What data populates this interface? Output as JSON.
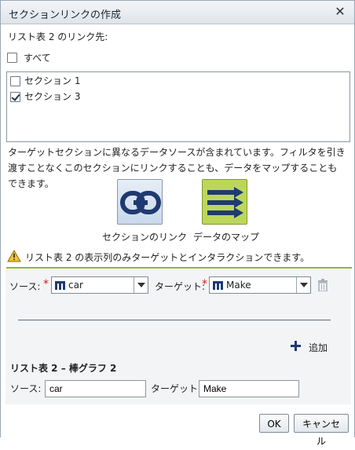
{
  "dialog": {
    "title": "セクションリンクの作成",
    "close_icon": "close-icon"
  },
  "link_target": {
    "label": "リスト表 2 のリンク先:",
    "all_label": "すべて",
    "all_checked": false,
    "sections": [
      {
        "label": "セクション 1",
        "checked": false
      },
      {
        "label": "セクション 3",
        "checked": true
      }
    ]
  },
  "info_text": "ターゲットセクションに異なるデータソースが含まれています。フィルタを引き渡すことなくこのセクションにリンクすることも、データをマップすることもできます。",
  "options": {
    "link_label": "セクションのリンク",
    "link_icon": "chain-link-icon",
    "map_label": "データのマップ",
    "map_icon": "arrows-right-icon",
    "selected": "map"
  },
  "warning": {
    "icon": "warning-icon",
    "text": "リスト表 2 の表示列のみターゲットとインタラクションできます。"
  },
  "mapping": {
    "source_label": "ソース:",
    "source_value": "car",
    "target_label": "ターゲット:",
    "target_value": "Make",
    "add_label": "追加",
    "add_icon": "plus-icon",
    "delete_icon": "trash-icon"
  },
  "detail": {
    "heading": "リスト表 2 – 棒グラフ 2",
    "source_label": "ソース:",
    "source_value": "car",
    "target_label": "ターゲット:",
    "target_value": "Make"
  },
  "buttons": {
    "ok": "OK",
    "cancel": "キャンセル"
  },
  "colors": {
    "accent_green": "#8fb33a",
    "map_button": "#bcd65a",
    "required": "#d32020",
    "icon_navy": "#1f3a70"
  }
}
